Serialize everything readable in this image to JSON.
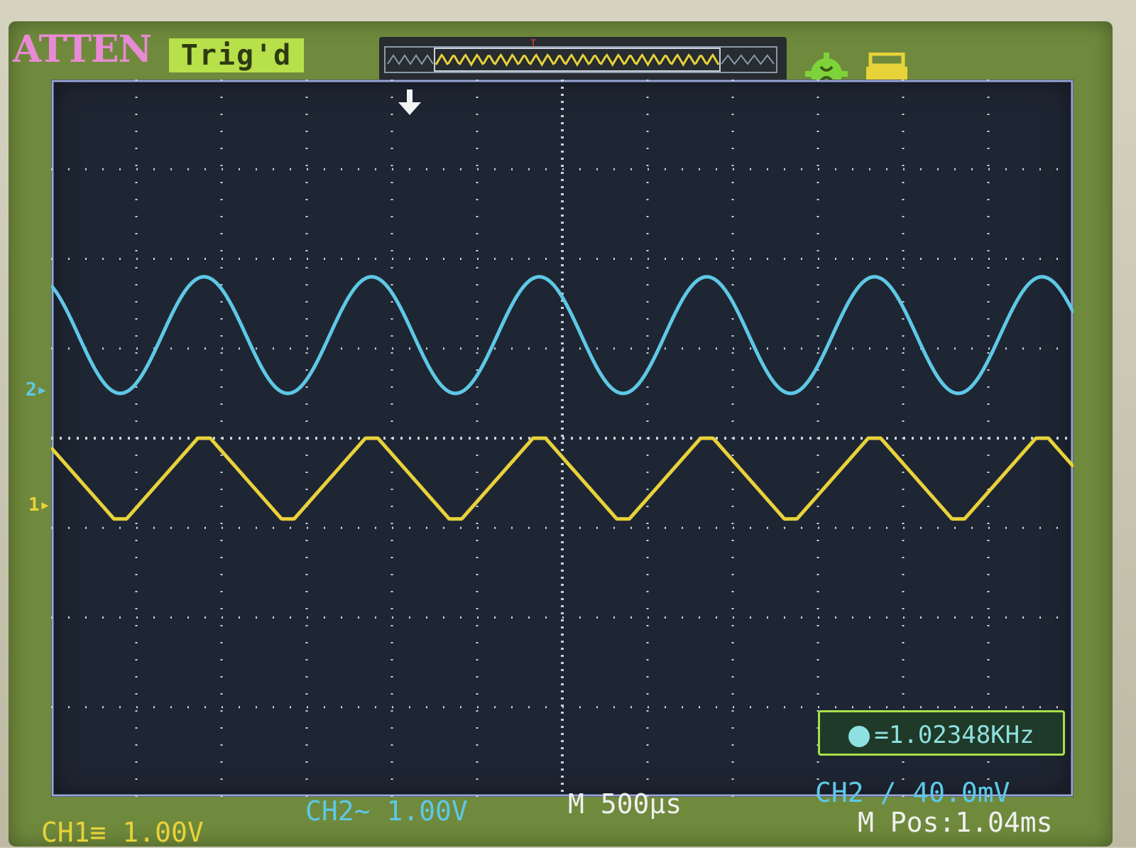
{
  "header": {
    "brand": "ATTEN",
    "trigger_status": "Trig'd",
    "trigger_marker_label": "T"
  },
  "display": {
    "ch1_marker": "1",
    "ch2_marker": "2",
    "frequency_readout": "=1.02348KHz"
  },
  "footer": {
    "ch1_scale": "CH1≡ 1.00V",
    "ch2_scale": "CH2∼ 1.00V",
    "timebase": "M 500μs",
    "trigger_level": "CH2 ∕ 40.0mV",
    "m_pos": "M Pos:1.04ms"
  },
  "colors": {
    "ch1": "#e8d23a",
    "ch2": "#5ec8e6",
    "badge": "#b8e04a",
    "brand": "#e88ad4",
    "grid": "#c8d0dc"
  },
  "icons": {
    "run_icon": "gear-icon",
    "printer_icon": "printer-icon",
    "trigger_icon": "trigger-arrow-icon"
  },
  "chart_data": {
    "type": "line",
    "series": [
      {
        "name": "CH1",
        "color": "#e8d23a",
        "waveform": "triangle",
        "frequency_khz": 1.02348,
        "amplitude_div": 0.45,
        "offset_div": -0.45
      },
      {
        "name": "CH2",
        "color": "#5ec8e6",
        "waveform": "sine",
        "frequency_khz": 1.02348,
        "amplitude_div": 0.65,
        "offset_div": 1.15
      }
    ],
    "x_divisions": 12,
    "y_divisions": 8,
    "timebase_per_div": "500μs",
    "grid": true
  }
}
